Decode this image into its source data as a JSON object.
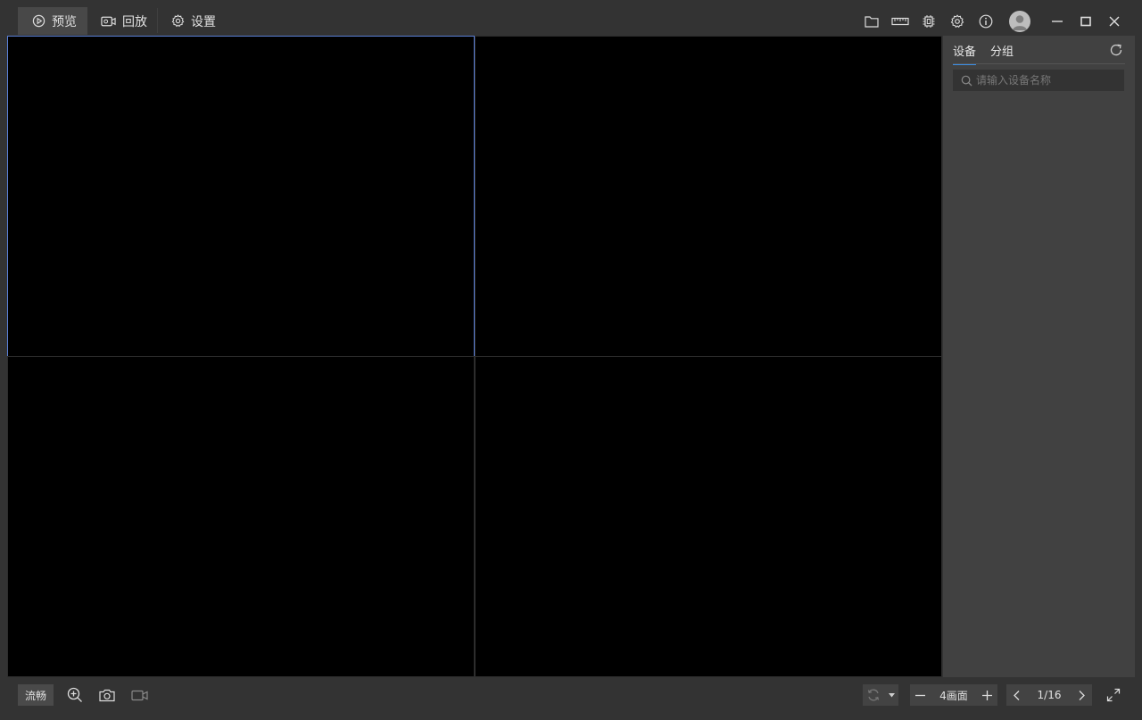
{
  "topbar": {
    "tabs": [
      {
        "label": "预览",
        "icon": "play-circle-icon",
        "active": true
      },
      {
        "label": "回放",
        "icon": "camera-playback-icon",
        "active": false
      },
      {
        "label": "设置",
        "icon": "gear-icon",
        "active": false
      }
    ],
    "right_icons": [
      "folder-icon",
      "ruler-icon",
      "chip-icon",
      "gear-icon",
      "info-icon",
      "avatar-icon",
      "minimize-icon",
      "maximize-icon",
      "close-icon"
    ]
  },
  "panel": {
    "tabs": [
      {
        "label": "设备",
        "active": true
      },
      {
        "label": "分组",
        "active": false
      }
    ],
    "search_placeholder": "请输入设备名称"
  },
  "bottombar": {
    "stream_mode": "流畅",
    "layout_label": "4画面",
    "page_indicator": "1/16"
  },
  "colors": {
    "background": "#333333",
    "panel": "#414141",
    "selected_border": "#5a7fd6",
    "accent": "#3a8ee6"
  }
}
